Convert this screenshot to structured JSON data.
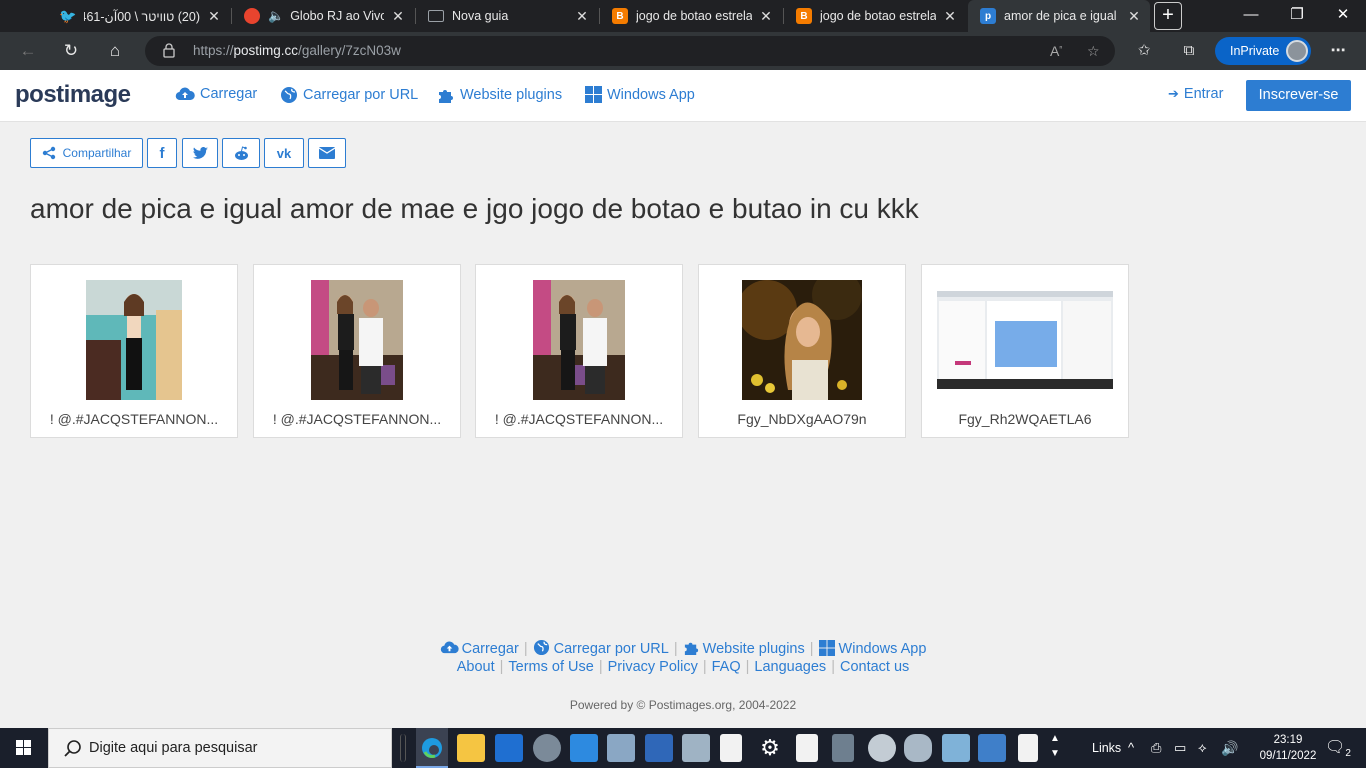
{
  "browser": {
    "tabs": [
      {
        "title": "(20) טוויטר \\ 00آن-461",
        "favicon": "twitter-icon",
        "favicon_color": "#1d9bf0"
      },
      {
        "title": "Globo RJ ao Vivo",
        "favicon": "globo-icon",
        "favicon_color": "#e8442e",
        "audio": true
      },
      {
        "title": "Nova guia",
        "favicon": "newtab-icon",
        "favicon_color": "#9aa0a6"
      },
      {
        "title": "jogo de botao estrela",
        "favicon": "blogger-icon",
        "favicon_color": "#f57c00"
      },
      {
        "title": "jogo de botao estrela",
        "favicon": "blogger-icon",
        "favicon_color": "#f57c00"
      },
      {
        "title": "amor de pica e igual amor de mae",
        "favicon": "postimage-icon",
        "favicon_color": "#2d7dd2",
        "active": true
      }
    ],
    "url_prefix": "https://",
    "url_domain": "postimg.cc",
    "url_path": "/gallery/7zcN03w",
    "inprivate_label": "InPrivate"
  },
  "site": {
    "logo": "postimage",
    "nav": [
      {
        "label": "Carregar",
        "icon": "cloud-upload-icon"
      },
      {
        "label": "Carregar por URL",
        "icon": "globe-icon"
      },
      {
        "label": "Website plugins",
        "icon": "puzzle-icon"
      },
      {
        "label": "Windows App",
        "icon": "windows-icon"
      }
    ],
    "login_label": "Entrar",
    "signup_label": "Inscrever-se"
  },
  "share": {
    "label": "Compartilhar",
    "networks": [
      "facebook-icon",
      "twitter-icon",
      "reddit-icon",
      "vk-icon",
      "envelope-icon"
    ]
  },
  "gallery": {
    "title": "amor de pica e igual amor de mae e jgo jogo de botao e butao in cu kkk",
    "images": [
      {
        "caption": "! @.#JACQSTEFANNON..."
      },
      {
        "caption": "! @.#JACQSTEFANNON..."
      },
      {
        "caption": "! @.#JACQSTEFANNON..."
      },
      {
        "caption": "Fgy_NbDXgAAO79n"
      },
      {
        "caption": "Fgy_Rh2WQAETLA6"
      }
    ]
  },
  "footer": {
    "row1": [
      "Carregar",
      "Carregar por URL",
      "Website plugins",
      "Windows App"
    ],
    "row2": [
      "About",
      "Terms of Use",
      "Privacy Policy",
      "FAQ",
      "Languages",
      "Contact us"
    ],
    "powered": "Powered by © Postimages.org, 2004-2022"
  },
  "taskbar": {
    "search_placeholder": "Digite aqui para pesquisar",
    "links_label": "Links",
    "time": "23:19",
    "date": "09/11/2022",
    "notifications": "2"
  },
  "colors": {
    "accent": "#2d7dd2",
    "tabstrip": "#202124",
    "taskbar": "#1a1f2b"
  }
}
